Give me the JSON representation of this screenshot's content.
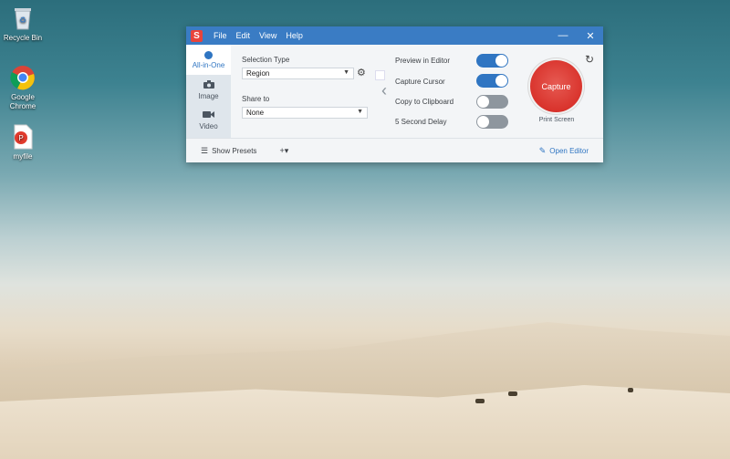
{
  "desktop": {
    "icons": [
      {
        "label": "Recycle Bin"
      },
      {
        "label": "Google Chrome"
      },
      {
        "label": "myfile"
      }
    ]
  },
  "window": {
    "logo": "S",
    "menu": [
      "File",
      "Edit",
      "View",
      "Help"
    ],
    "minimize": "—",
    "close": "✕",
    "tabs": [
      {
        "label": "All-in-One",
        "icon": "circle-dot-icon",
        "active": true
      },
      {
        "label": "Image",
        "icon": "camera-icon"
      },
      {
        "label": "Video",
        "icon": "video-camera-icon"
      }
    ],
    "selection_type": {
      "label": "Selection Type",
      "value": "Region"
    },
    "share_to": {
      "label": "Share to",
      "value": "None"
    },
    "options": [
      {
        "label": "Preview in Editor",
        "on": true
      },
      {
        "label": "Capture Cursor",
        "on": true
      },
      {
        "label": "Copy to Clipboard",
        "on": false
      },
      {
        "label": "5 Second Delay",
        "on": false
      }
    ],
    "capture": {
      "label": "Capture",
      "shortcut": "Print Screen"
    },
    "footer": {
      "show_presets": "Show Presets",
      "add": "+▾",
      "open_editor": "Open Editor"
    },
    "colors": {
      "accent": "#2f75c2",
      "title_bar": "#3a7cc4",
      "capture_red": "#d9332c"
    }
  }
}
